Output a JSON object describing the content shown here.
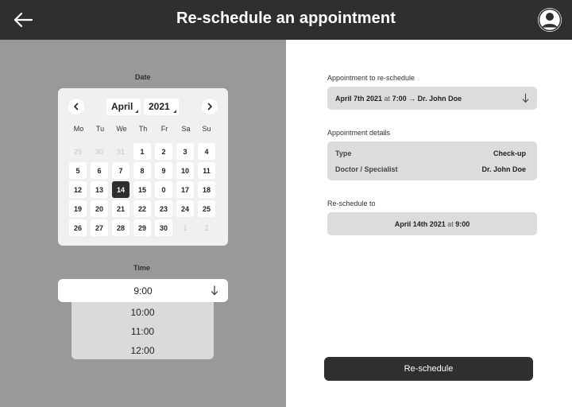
{
  "header": {
    "title": "Re-schedule an appointment",
    "back_icon": "arrow-left-icon",
    "avatar_icon": "user-avatar-icon"
  },
  "left": {
    "date_label": "Date",
    "time_label": "Time",
    "calendar": {
      "month": "April",
      "year": "2021",
      "weekdays": [
        "Mo",
        "Tu",
        "We",
        "Th",
        "Fr",
        "Sa",
        "Su"
      ],
      "weeks": [
        [
          "29",
          "30",
          "31",
          "1",
          "2",
          "3",
          "4"
        ],
        [
          "5",
          "6",
          "7",
          "8",
          "9",
          "10",
          "11"
        ],
        [
          "12",
          "13",
          "14",
          "15",
          "0",
          "17",
          "18"
        ],
        [
          "19",
          "20",
          "21",
          "22",
          "23",
          "24",
          "25"
        ],
        [
          "26",
          "27",
          "28",
          "29",
          "30",
          "1",
          "2"
        ]
      ],
      "selected_day": "14"
    },
    "time": {
      "selected": "9:00",
      "options": [
        "10:00",
        "11:00",
        "12:00"
      ]
    }
  },
  "right": {
    "appointment_label": "Appointment to re-schedule",
    "appointment": {
      "date": "April 7th 2021",
      "at": "at",
      "time": "7:00",
      "arrow": "→",
      "doctor": "Dr. John Doe"
    },
    "details_label": "Appointment details",
    "details": [
      {
        "key": "Type",
        "value": "Check-up"
      },
      {
        "key": "Doctor / Specialist",
        "value": "Dr. John Doe"
      }
    ],
    "reschedule_label": "Re-schedule to",
    "reschedule": {
      "date": "April 14th 2021",
      "at": "at",
      "time": "9:00"
    },
    "button_label": "Re-schedule"
  },
  "colors": {
    "dark": "#2f2f2f",
    "left_pane": "#999999",
    "field": "#dcdcdc"
  }
}
